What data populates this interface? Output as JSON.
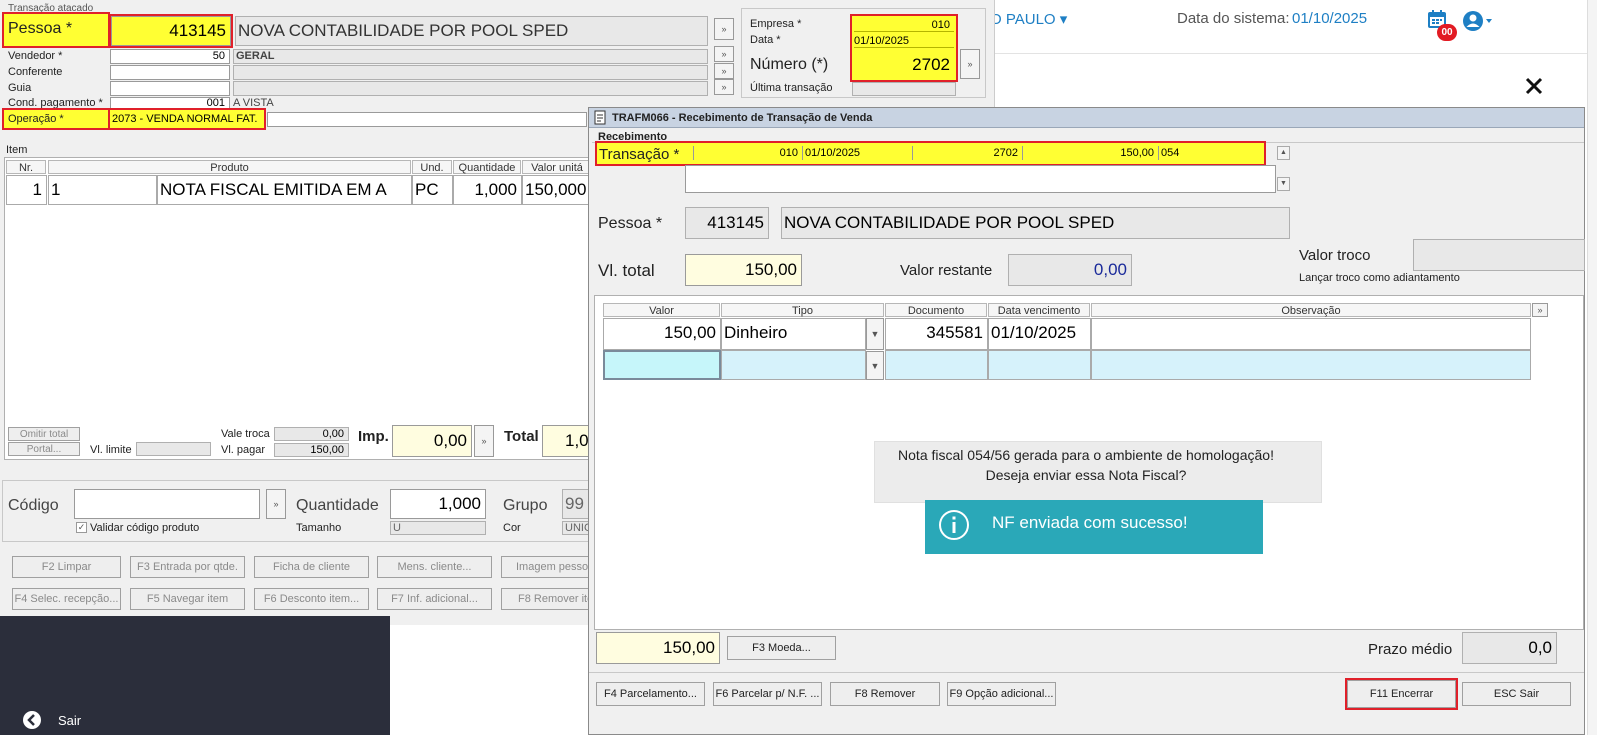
{
  "topbar": {
    "city": "O PAULO",
    "system_date_label": "Data do sistema:",
    "system_date": "01/10/2025",
    "badge": "00"
  },
  "bg": {
    "title": "Transação atacado",
    "pessoa_label": "Pessoa *",
    "pessoa_code": "413145",
    "pessoa_name": "NOVA CONTABILIDADE POR POOL SPED",
    "vendedor_label": "Vendedor *",
    "vendedor_value": "50",
    "vendedor_name": "GERAL",
    "conferente_label": "Conferente",
    "guia_label": "Guia",
    "cond_label": "Cond. pagamento *",
    "cond_value": "001",
    "cond_name": "A VISTA",
    "operacao_label": "Operação *",
    "operacao_value": "2073 - VENDA NORMAL FAT.",
    "empresa_label": "Empresa *",
    "empresa_value": "010",
    "data_label": "Data *",
    "data_value": "01/10/2025",
    "numero_label": "Número (*)",
    "numero_value": "2702",
    "ultima_label": "Última transação",
    "item_title": "Item",
    "item_headers": [
      "Nr.",
      "Produto",
      "Und.",
      "Quantidade",
      "Valor unitá"
    ],
    "item_row": {
      "nr": "1",
      "code": "1",
      "produto": "NOTA FISCAL EMITIDA EM A",
      "und": "PC",
      "qtd": "1,000",
      "valor": "150,000"
    },
    "omitir_label": "Omitir total",
    "portal_label": "Portal...",
    "vl_limite_label": "Vl. limite",
    "vale_troca_label": "Vale troca",
    "vale_troca_value": "0,00",
    "vl_pagar_label": "Vl. pagar",
    "vl_pagar_value": "150,00",
    "imp_label": "Imp.",
    "imp_value": "0,00",
    "total_label": "Total",
    "total_value": "1,0",
    "codigo_label": "Código",
    "validar_label": "Validar código produto",
    "quantidade_label": "Quantidade",
    "quantidade_value": "1,000",
    "tamanho_label": "Tamanho",
    "tamanho_value": "U",
    "grupo_label": "Grupo",
    "grupo_value": "99",
    "cor_label": "Cor",
    "cor_value": "UNIC",
    "buttons_row1": [
      "F2 Limpar",
      "F3 Entrada por qtde.",
      "Ficha de cliente",
      "Mens. cliente...",
      "Imagem pessoa"
    ],
    "buttons_row2": [
      "F4 Selec. recepção...",
      "F5 Navegar item",
      "F6 Desconto item...",
      "F7 Inf. adicional...",
      "F8 Remover ite"
    ],
    "sair_label": "Sair"
  },
  "modal": {
    "title": "TRAFM066 - Recebimento de Transação de Venda",
    "recebimento_label": "Recebimento",
    "transacao_label": "Transação *",
    "transacao_empresa": "010",
    "transacao_data": "01/10/2025",
    "transacao_numero": "2702",
    "transacao_valor": "150,00",
    "transacao_serie": "054",
    "pessoa_label": "Pessoa *",
    "pessoa_code": "413145",
    "pessoa_name": "NOVA CONTABILIDADE POR POOL SPED",
    "vl_total_label": "Vl. total",
    "vl_total_value": "150,00",
    "valor_restante_label": "Valor restante",
    "valor_restante_value": "0,00",
    "valor_troco_label": "Valor troco",
    "lancar_troco_label": "Lançar troco como adiantamento",
    "grid_headers": [
      "Valor",
      "Tipo",
      "Documento",
      "Data vencimento",
      "Observação"
    ],
    "grid_row": {
      "valor": "150,00",
      "tipo": "Dinheiro",
      "documento": "345581",
      "vencimento": "01/10/2025",
      "observacao": ""
    },
    "dialog_line1": "Nota fiscal 054/56 gerada para o ambiente de homologação!",
    "dialog_line2": "Deseja enviar essa Nota Fiscal?",
    "toast": "NF enviada com sucesso!",
    "footer_total": "150,00",
    "moeda_button": "F3 Moeda...",
    "prazo_label": "Prazo médio",
    "prazo_value": "0,0",
    "buttons": [
      "F4 Parcelamento...",
      "F6 Parcelar p/ N.F. ...",
      "F8 Remover",
      "F9 Opção adicional...",
      "F11 Encerrar",
      "ESC Sair"
    ]
  },
  "colors": {
    "highlight": "#ffff33",
    "outline": "#e0202a",
    "toast": "#2aa8b8",
    "link": "#1e7fc4"
  }
}
